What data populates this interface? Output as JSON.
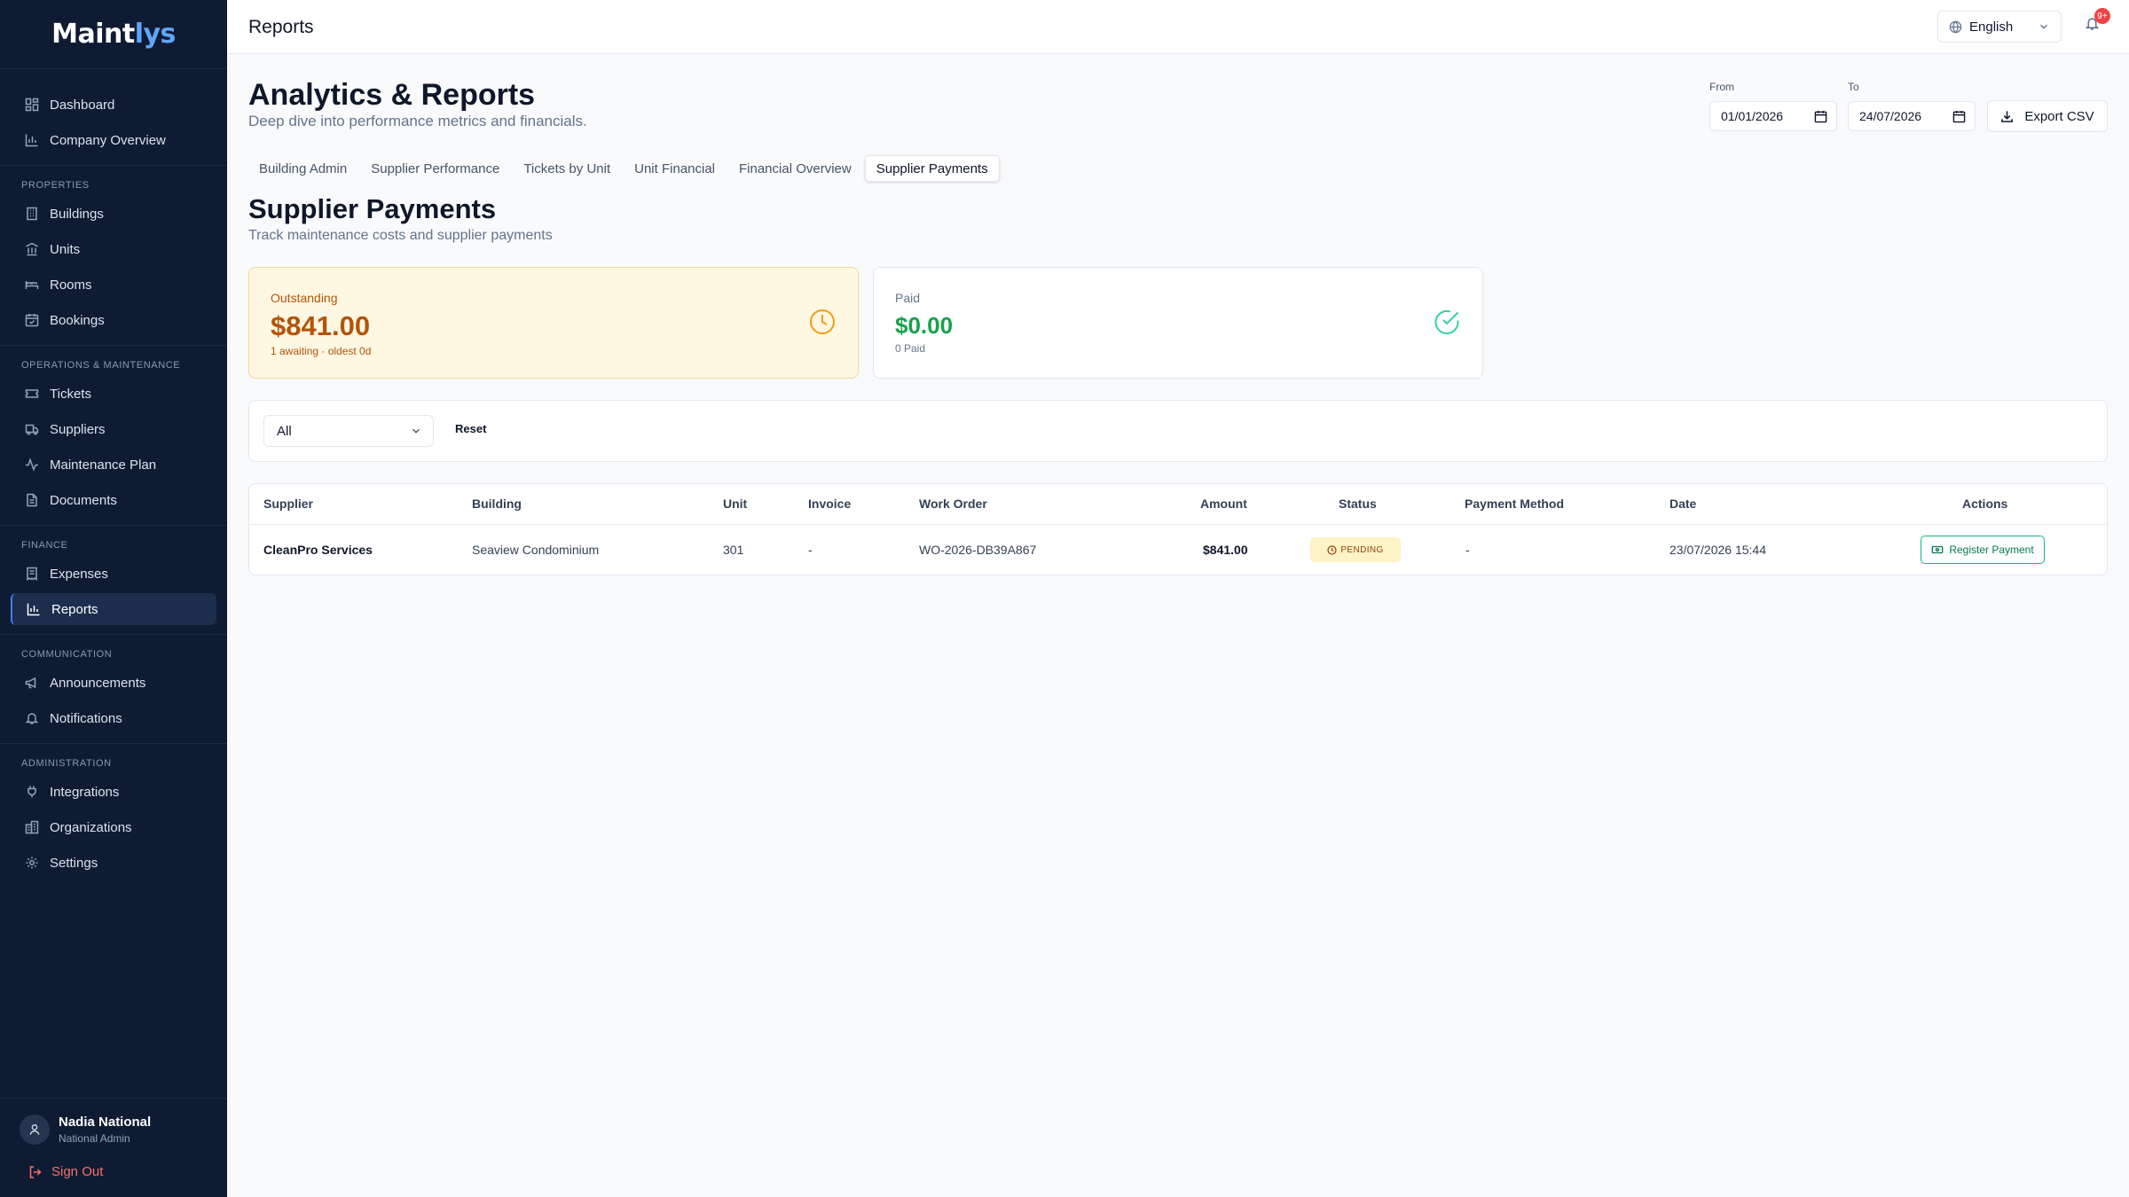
{
  "brand": {
    "part1": "Maint",
    "part2": "lys"
  },
  "sidebar": {
    "top": [
      {
        "label": "Dashboard",
        "icon": "dashboard-icon"
      },
      {
        "label": "Company Overview",
        "icon": "bar-chart-icon"
      }
    ],
    "groups": [
      {
        "heading": "PROPERTIES",
        "items": [
          {
            "label": "Buildings",
            "icon": "building-icon"
          },
          {
            "label": "Units",
            "icon": "library-icon"
          },
          {
            "label": "Rooms",
            "icon": "bed-icon"
          },
          {
            "label": "Bookings",
            "icon": "calendar-check-icon"
          }
        ]
      },
      {
        "heading": "OPERATIONS & MAINTENANCE",
        "items": [
          {
            "label": "Tickets",
            "icon": "ticket-icon"
          },
          {
            "label": "Suppliers",
            "icon": "truck-icon"
          },
          {
            "label": "Maintenance Plan",
            "icon": "activity-icon"
          },
          {
            "label": "Documents",
            "icon": "document-icon"
          }
        ]
      },
      {
        "heading": "FINANCE",
        "items": [
          {
            "label": "Expenses",
            "icon": "receipt-icon"
          },
          {
            "label": "Reports",
            "icon": "bar-chart-icon",
            "active": true
          }
        ]
      },
      {
        "heading": "COMMUNICATION",
        "items": [
          {
            "label": "Announcements",
            "icon": "megaphone-icon"
          },
          {
            "label": "Notifications",
            "icon": "bell-icon"
          }
        ]
      },
      {
        "heading": "ADMINISTRATION",
        "items": [
          {
            "label": "Integrations",
            "icon": "plug-icon"
          },
          {
            "label": "Organizations",
            "icon": "building-icon"
          },
          {
            "label": "Settings",
            "icon": "gear-icon"
          }
        ]
      }
    ]
  },
  "user": {
    "name": "Nadia National",
    "role": "National Admin",
    "sign_out": "Sign Out"
  },
  "topbar": {
    "title": "Reports",
    "language": "English",
    "notification_count": "9+"
  },
  "header": {
    "title": "Analytics & Reports",
    "subtitle": "Deep dive into performance metrics and financials."
  },
  "date_range": {
    "from_label": "From",
    "from_value": "01/01/2026",
    "to_label": "To",
    "to_value": "24/07/2026",
    "export_label": "Export CSV"
  },
  "tabs": [
    {
      "label": "Building Admin"
    },
    {
      "label": "Supplier Performance"
    },
    {
      "label": "Tickets by Unit"
    },
    {
      "label": "Unit Financial"
    },
    {
      "label": "Financial Overview"
    },
    {
      "label": "Supplier Payments",
      "active": true
    }
  ],
  "section": {
    "title": "Supplier Payments",
    "subtitle": "Track maintenance costs and supplier payments"
  },
  "cards": {
    "outstanding": {
      "label": "Outstanding",
      "value": "$841.00",
      "sub": "1 awaiting · oldest 0d"
    },
    "paid": {
      "label": "Paid",
      "value": "$0.00",
      "sub": "0 Paid"
    }
  },
  "filter": {
    "selected": "All",
    "reset_label": "Reset"
  },
  "table": {
    "headers": {
      "supplier": "Supplier",
      "building": "Building",
      "unit": "Unit",
      "invoice": "Invoice",
      "work_order": "Work Order",
      "amount": "Amount",
      "status": "Status",
      "payment_method": "Payment Method",
      "date": "Date",
      "actions": "Actions"
    },
    "rows": [
      {
        "supplier": "CleanPro Services",
        "building": "Seaview Condominium",
        "unit": "301",
        "invoice": "-",
        "work_order": "WO-2026-DB39A867",
        "amount": "$841.00",
        "status": "PENDING",
        "payment_method": "-",
        "date": "23/07/2026 15:44",
        "action_label": "Register Payment"
      }
    ]
  },
  "colors": {
    "sidebar_bg": "#0f1b33",
    "accent": "#3b82f6",
    "outstanding": "#b45309",
    "paid": "#16a34a",
    "pending_badge": "#fef3c7",
    "register_border": "#10b981"
  }
}
